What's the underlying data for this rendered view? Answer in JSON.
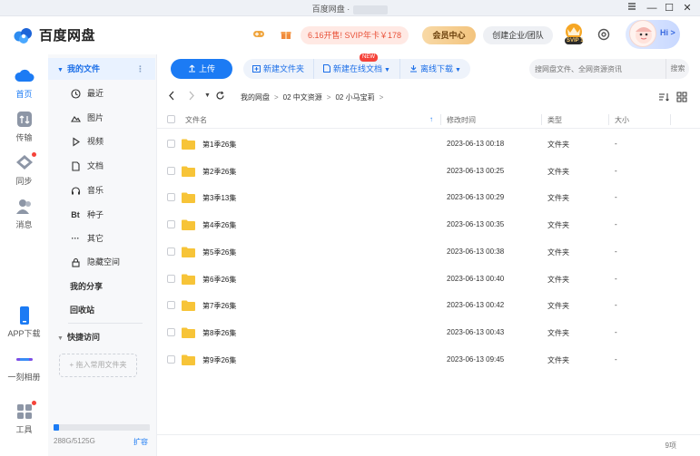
{
  "window": {
    "title": "百度网盘 ·",
    "minimize": "—",
    "maximize": "☐",
    "close": "✕"
  },
  "header": {
    "logo_text": "百度网盘",
    "promo_text": "6.16开售! SVIP年卡￥178",
    "vip_center": "会员中心",
    "biz_team": "创建企业/团队",
    "svip_label": "SVIP 1",
    "greeting": "Hi >"
  },
  "rail": {
    "items": [
      {
        "label": "首页"
      },
      {
        "label": "传输"
      },
      {
        "label": "同步"
      },
      {
        "label": "消息"
      },
      {
        "label": "APP下载"
      },
      {
        "label": "一刻相册"
      },
      {
        "label": "工具"
      }
    ]
  },
  "sidebar": {
    "my_files": "我的文件",
    "items": [
      {
        "label": "最近",
        "icon": "clock-icon"
      },
      {
        "label": "图片",
        "icon": "image-icon"
      },
      {
        "label": "视频",
        "icon": "play-icon"
      },
      {
        "label": "文档",
        "icon": "document-icon"
      },
      {
        "label": "音乐",
        "icon": "headphone-icon"
      },
      {
        "label": "种子",
        "icon": "bt-icon",
        "glyph": "Bt"
      },
      {
        "label": "其它",
        "icon": "more-icon",
        "glyph": "···"
      },
      {
        "label": "隐藏空间",
        "icon": "lock-icon"
      }
    ],
    "my_share": "我的分享",
    "recycle": "回收站",
    "quick_access": "快捷访问",
    "drop_hint": "+ 拖入常用文件夹",
    "storage_text": "288G/5125G",
    "storage_used": 0.056,
    "expand": "扩容"
  },
  "toolbar": {
    "upload": "上传",
    "new_folder": "新建文件夹",
    "new_online_doc": "新建在线文档",
    "new_badge": "NEW",
    "offline_download": "离线下载",
    "search_placeholder": "搜网盘文件、全网资源资讯",
    "search_button": "搜索"
  },
  "breadcrumb": {
    "items": [
      "我的网盘",
      "02 中文资源",
      "02 小马宝莉"
    ],
    "sep": ">"
  },
  "table": {
    "headers": {
      "name": "文件名",
      "modified": "修改时间",
      "type": "类型",
      "size": "大小"
    },
    "rows": [
      {
        "name": "第1季26集",
        "modified": "2023-06-13 00:18",
        "type": "文件夹",
        "size": "-"
      },
      {
        "name": "第2季26集",
        "modified": "2023-06-13 00:25",
        "type": "文件夹",
        "size": "-"
      },
      {
        "name": "第3季13集",
        "modified": "2023-06-13 00:29",
        "type": "文件夹",
        "size": "-"
      },
      {
        "name": "第4季26集",
        "modified": "2023-06-13 00:35",
        "type": "文件夹",
        "size": "-"
      },
      {
        "name": "第5季26集",
        "modified": "2023-06-13 00:38",
        "type": "文件夹",
        "size": "-"
      },
      {
        "name": "第6季26集",
        "modified": "2023-06-13 00:40",
        "type": "文件夹",
        "size": "-"
      },
      {
        "name": "第7季26集",
        "modified": "2023-06-13 00:42",
        "type": "文件夹",
        "size": "-"
      },
      {
        "name": "第8季26集",
        "modified": "2023-06-13 00:43",
        "type": "文件夹",
        "size": "-"
      },
      {
        "name": "第9季26集",
        "modified": "2023-06-13 09:45",
        "type": "文件夹",
        "size": "-"
      }
    ]
  },
  "footer": {
    "count": "9项"
  },
  "colors": {
    "accent": "#1c7bf4",
    "folder": "#f7c438",
    "promo": "#e8523a",
    "badge": "#f5433a"
  }
}
